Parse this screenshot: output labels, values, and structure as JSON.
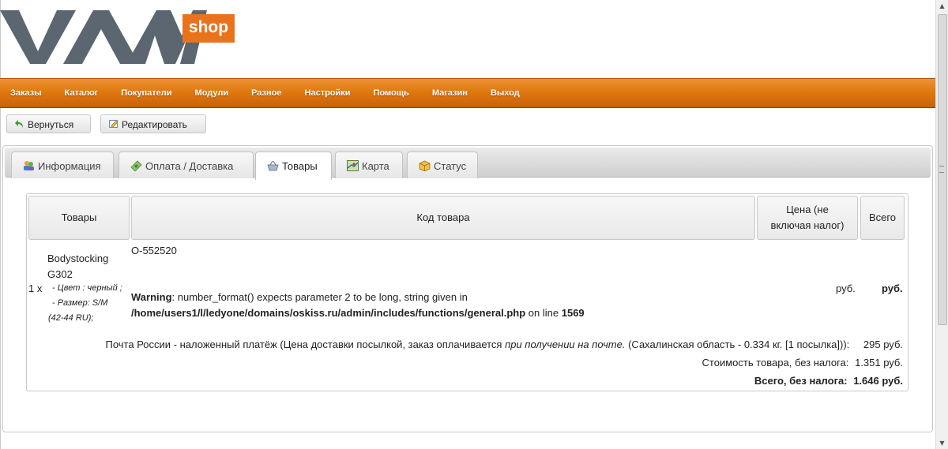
{
  "logo": {
    "text": "VAM",
    "badge": "shop"
  },
  "nav": {
    "items": [
      "Заказы",
      "Каталог",
      "Покупатели",
      "Модули",
      "Разное",
      "Настройки",
      "Помощь",
      "Магазин",
      "Выход"
    ]
  },
  "toolbar": {
    "back_label": "Вернуться",
    "edit_label": "Редактировать"
  },
  "tabs": [
    {
      "label": "Информация",
      "icon": "users-icon",
      "active": false
    },
    {
      "label": "Оплата / Доставка",
      "icon": "money-icon",
      "active": false
    },
    {
      "label": "Товары",
      "icon": "basket-icon",
      "active": true
    },
    {
      "label": "Карта",
      "icon": "map-icon",
      "active": false
    },
    {
      "label": "Статус",
      "icon": "box-icon",
      "active": false
    }
  ],
  "table": {
    "headers": {
      "products": "Товары",
      "code": "Код товара",
      "price": "Цена (не включая налог)",
      "total": "Всего"
    },
    "row": {
      "qty": "1 x",
      "name_line1": "Bodystocking",
      "name_line2": "G302",
      "attr_color": "- Цвет : черный ;",
      "attr_size": "- Размер: S/M",
      "attr_size2": "(42-44 RU);",
      "code": "O-552520",
      "warning_label": "Warning",
      "warning_text": ": number_format() expects parameter 2 to be long, string given in",
      "warning_path": "/home/users1/l/ledyone/domains/oskiss.ru/admin/includes/functions/general.php",
      "warning_online": " on line ",
      "warning_line": "1569",
      "price": "руб.",
      "total": "руб."
    },
    "totals": {
      "shipping_a": "Почта России - наложенный платёж (Цена доставки посылкой, заказ оплачивается ",
      "shipping_em": "при получении на почте.",
      "shipping_b": " (Сахалинская область - 0.334 кг. [1 посылка])):",
      "shipping_value": "295 руб.",
      "subtotal_label": "Стоимость товара, без налога:",
      "subtotal_value": "1.351 руб.",
      "total_label": "Всего, без налога:",
      "total_value": "1.646 руб."
    }
  },
  "colors": {
    "nav_orange": "#e0780f",
    "logo_gray": "#5b6670",
    "logo_orange": "#e9731c"
  }
}
